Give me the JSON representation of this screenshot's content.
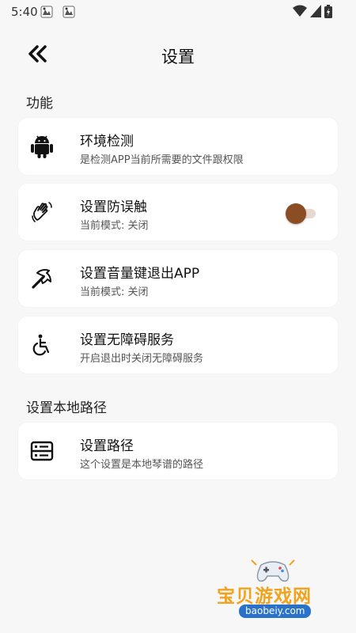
{
  "status_bar": {
    "time": "5:40"
  },
  "header": {
    "title": "设置"
  },
  "sections": {
    "functions": {
      "title": "功能",
      "items": [
        {
          "title": "环境检测",
          "subtitle": "是检测APP当前所需要的文件跟权限",
          "icon": "android-icon"
        },
        {
          "title": "设置防误触",
          "subtitle": "当前模式: 关闭",
          "icon": "hand-wave-icon",
          "toggle": false
        },
        {
          "title": "设置音量键退出APP",
          "subtitle": "当前模式: 关闭",
          "icon": "pickaxe-icon"
        },
        {
          "title": "设置无障碍服务",
          "subtitle": "开启退出时关闭无障碍服务",
          "icon": "accessibility-icon"
        }
      ]
    },
    "local_path": {
      "title": "设置本地路径",
      "items": [
        {
          "title": "设置路径",
          "subtitle": "这个设置是本地琴谱的路径",
          "icon": "storage-icon"
        }
      ]
    }
  },
  "watermark": {
    "title": "宝贝游戏网",
    "url": "baobeiy.com"
  },
  "colors": {
    "background": "#f7f7f7",
    "card": "#ffffff",
    "toggle_thumb": "#8a4d24",
    "toggle_track": "#e7d9cf",
    "icon": "#111111"
  }
}
